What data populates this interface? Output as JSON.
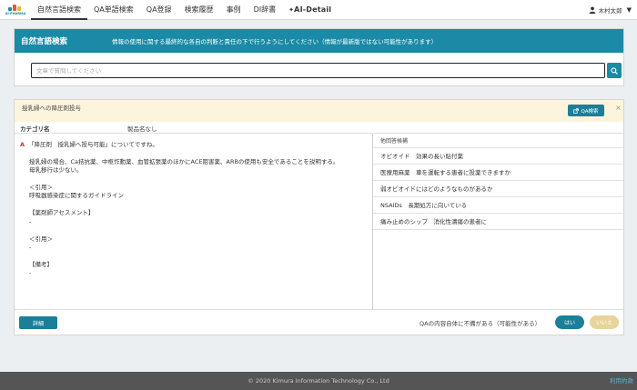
{
  "brand": {
    "logo_text": "AI PHARMA",
    "colors": {
      "primary": "#1b8aa6",
      "accent": "#1b7f99",
      "warning_bg": "#fcf4dc",
      "no_button": "#e8d49a"
    }
  },
  "nav": {
    "tabs": [
      {
        "label": "自然言語検索",
        "active": true
      },
      {
        "label": "QA単語検索"
      },
      {
        "label": "QA登録"
      },
      {
        "label": "検索履歴"
      },
      {
        "label": "事例"
      },
      {
        "label": "DI辞書"
      }
    ],
    "ai_logo": "AI-Detail",
    "user_name": "木村太郎",
    "user_icon": "person-icon",
    "user_caret": "▼"
  },
  "search": {
    "title": "自然言語検索",
    "note": "情報の使用に関する最終的な各自の判断と責任の下で行うようにしてください（情報が最新版ではない可能性があります）",
    "input_value": "",
    "placeholder": "文章で質問してください",
    "button_icon": "search-icon"
  },
  "result": {
    "query": "授乳婦への降圧剤投与",
    "qa_search_label": "QA検索",
    "qa_search_icon": "external-link-icon",
    "close_label": "×",
    "category_label": "カテゴリ名",
    "category_value": "製品名なし",
    "answer": {
      "marker": "A",
      "headline": "「降圧剤　授乳婦へ投与可能」についてですね。",
      "body_1": "授乳婦の場合、Ca拮抗薬、中枢作動薬、血管拡張薬のほかにACE阻害薬、ARBの使用も安全であることを説明する。",
      "body_2": "母乳移行は少ない。",
      "ref_heading_1": "＜引用＞",
      "ref_1": "呼吸器感染症に関するガイドライン",
      "pharm_heading": "【薬剤師アセスメント】",
      "pharm_value": "-",
      "ref_heading_2": "＜引用＞",
      "ref_2": "-",
      "note_heading": "【備考】",
      "note_value": "-"
    },
    "candidates_title": "他回答候補",
    "candidates": [
      "オピオイド　効果の長い貼付薬",
      "医療用麻薬　車を運転する患者に投薬できますか",
      "弱オピオイドにはどのようなものがあるか",
      "NSAIDs　長期処方に向いている",
      "痛み止めのシップ　消化性潰瘍の患者に"
    ],
    "detail_label": "詳細",
    "feedback_text": "QAの内容自体に不備がある（可能性がある）",
    "yes_label": "はい",
    "no_label": "いいえ"
  },
  "footer": {
    "copyright": "© 2020 Kimura Information Technology Co., Ltd",
    "terms": "利用約款"
  }
}
